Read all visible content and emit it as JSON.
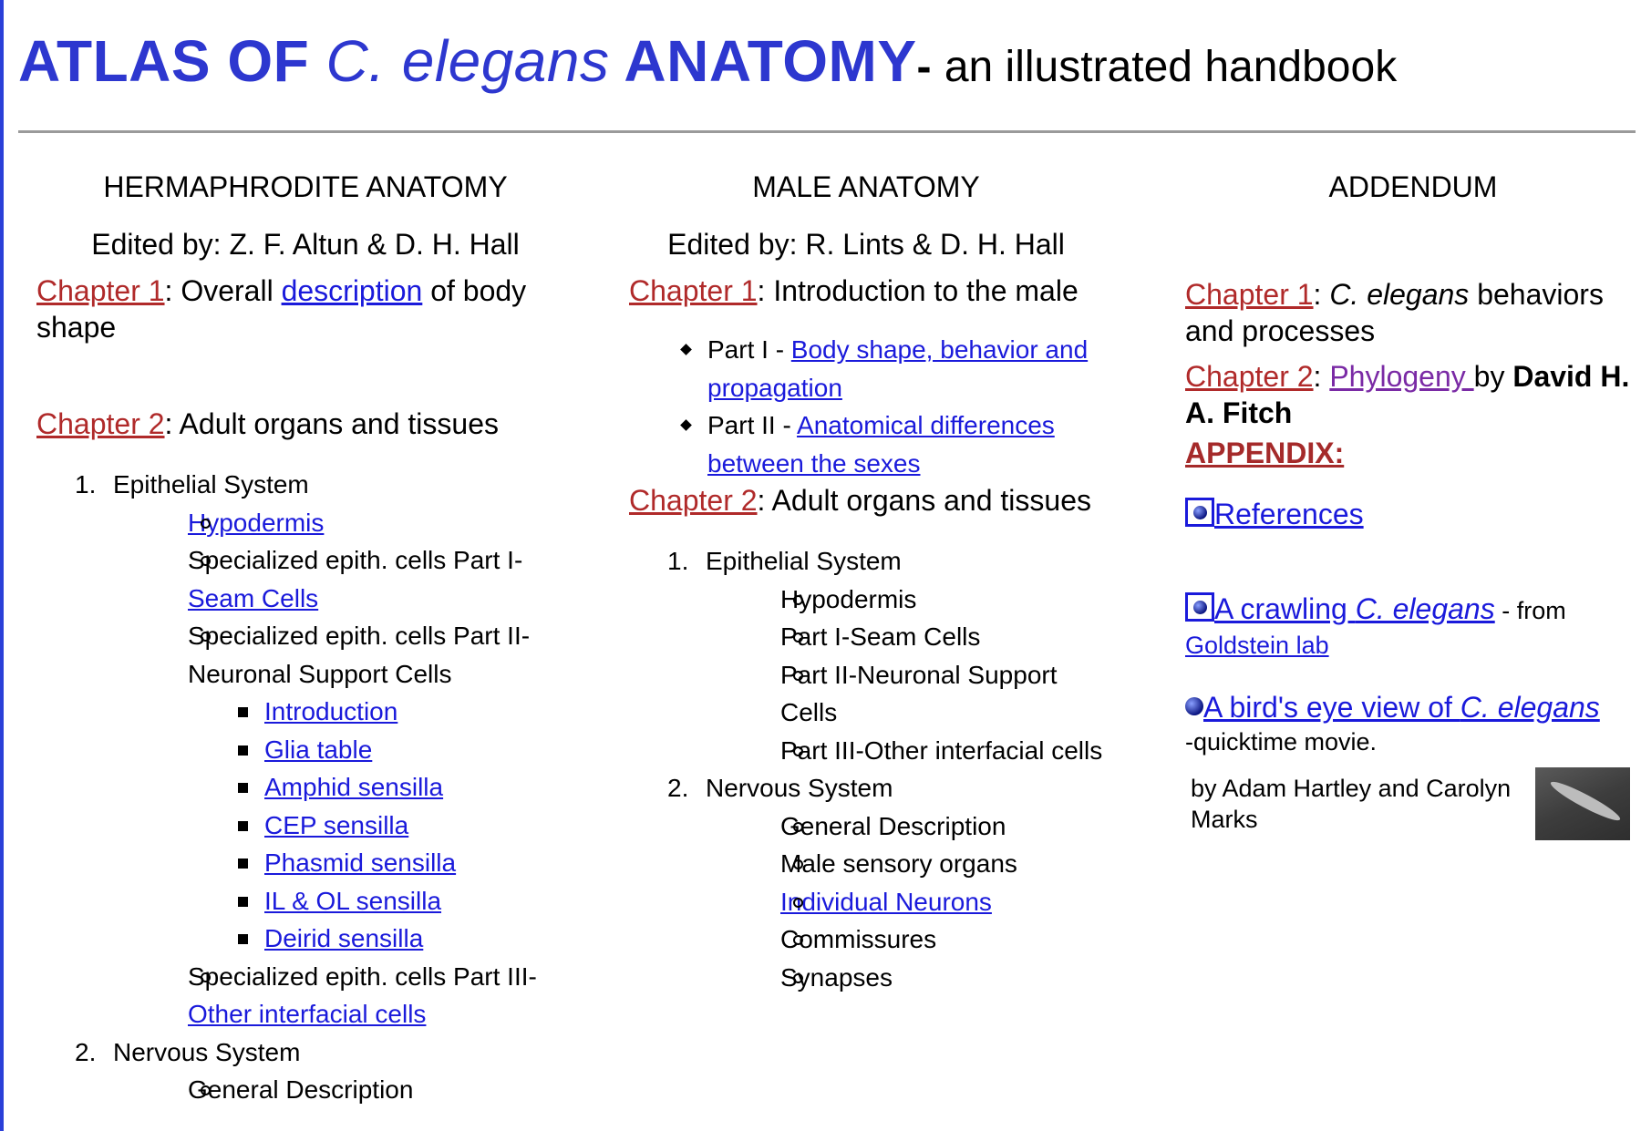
{
  "header": {
    "title_pre": "ATLAS OF ",
    "title_italic": "C. elegans",
    "title_post": " ANATOMY",
    "title_dash": "- ",
    "subtitle": "an illustrated handbook"
  },
  "herm": {
    "heading": "HERMAPHRODITE ANATOMY",
    "editor": "Edited by: Z. F. Altun & D. H. Hall",
    "ch1_label": "Chapter 1",
    "ch1_sep": ": Overall ",
    "ch1_link": "description",
    "ch1_rest": " of body shape",
    "ch2_label": "Chapter 2",
    "ch2_rest": ": Adult organs and tissues",
    "epithelial_num": "1.",
    "epithelial": "Epithelial System",
    "hypodermis": "Hypodermis",
    "spec1_prefix": "Specialized epith. cells Part I-",
    "spec1_link": "Seam Cells",
    "spec2": "Specialized epith. cells Part II-Neuronal Support Cells",
    "support_items": [
      "Introduction",
      "Glia table",
      "Amphid sensilla",
      "CEP sensilla",
      "Phasmid sensilla",
      "IL & OL sensilla",
      "Deirid sensilla"
    ],
    "spec3_prefix": "Specialized epith. cells Part III-",
    "spec3_link": "Other interfacial cells",
    "nervous_num": "2.",
    "nervous": "Nervous System",
    "nervous_first": "General Description"
  },
  "male": {
    "heading": "MALE ANATOMY",
    "editor": "Edited by: R. Lints & D. H. Hall",
    "ch1_label": "Chapter 1",
    "ch1_rest": ": Introduction to the male",
    "part1_prefix": "Part I - ",
    "part1_link": "Body shape, behavior and propagation",
    "part2_prefix": "Part II - ",
    "part2_link": "Anatomical differences between the sexes",
    "ch2_label": "Chapter 2",
    "ch2_rest": ": Adult organs and tissues",
    "epithelial_num": "1.",
    "epithelial": "Epithelial System",
    "epi_items": [
      "Hypodermis",
      "Part I-Seam Cells",
      "Part II-Neuronal Support Cells",
      "Part III-Other interfacial cells"
    ],
    "nervous_num": "2.",
    "nervous": "Nervous System",
    "nerv_general": "General Description",
    "nerv_sensory": "Male sensory organs",
    "nerv_neurons": "Individual Neurons",
    "nerv_commissures": "Commissures",
    "nerv_synapses": "Synapses"
  },
  "addendum": {
    "heading": "ADDENDUM",
    "ch1_label": "Chapter 1",
    "ch1_sep": ": ",
    "ch1_italic": "C. elegans",
    "ch1_rest": " behaviors and processes",
    "ch2_label": "Chapter 2",
    "ch2_sep": ": ",
    "ch2_link": "Phylogeny ",
    "ch2_by": "by ",
    "ch2_author": "David H. A. Fitch",
    "appendix": "APPENDIX:",
    "references": "References",
    "crawl_pre": "A crawling ",
    "crawl_italic": "C. elegans",
    "crawl_from": " - from",
    "crawl_lab": "Goldstein lab",
    "bird_pre": "A bird's eye view of ",
    "bird_italic": "C. elegans",
    "bird_note": "-quicktime movie.",
    "credit": "by Adam Hartley and Carolyn Marks"
  },
  "colors": {
    "title_blue": "#2d37cf",
    "link_blue": "#1a1adb",
    "chapter_red": "#b02a2a",
    "visited_purple": "#7a2aa5",
    "appendix_red": "#a52a2a",
    "rule_gray": "#9a9a9a"
  },
  "icons": [
    "blue-dot-link-icon",
    "blue-dot-icon",
    "worm-thumbnail-image"
  ]
}
